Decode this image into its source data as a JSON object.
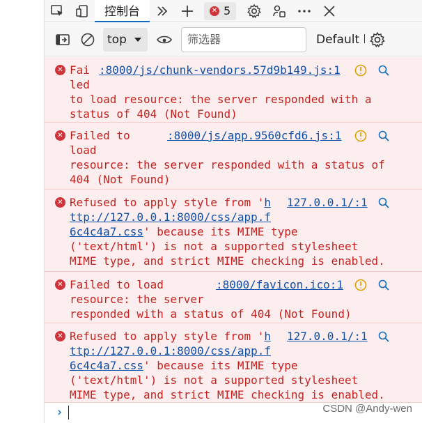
{
  "tabbar": {
    "active_tab": "控制台",
    "error_count": "5",
    "icons": [
      "inspect-icon",
      "device-icon",
      "more-tabs-icon",
      "add-tab-icon",
      "settings-icon",
      "customize-icon",
      "more-icon",
      "close-icon"
    ]
  },
  "toolbar": {
    "context": "top",
    "filter_placeholder": "筛选器",
    "levels": "Default l"
  },
  "messages": [
    {
      "lines": [
        "Fai",
        "led",
        "to load resource: the server responded with a",
        "status of 404 (Not Found)"
      ],
      "source": ":8000/js/chunk-vendors.57d9b149.js:1",
      "has_warning_action": true
    },
    {
      "lines": [
        "Failed to",
        "load",
        "resource: the server responded with a status of",
        "404 (Not Found)"
      ],
      "source": ":8000/js/app.9560cfd6.js:1",
      "has_warning_action": true
    },
    {
      "lines": [
        "Refused to apply style from '",
        "h",
        "ttp://127.0.0.1:8000/css/app.f",
        "6c4c4a7.css",
        "' because its MIME type",
        "('text/html') is not a supported stylesheet",
        "MIME type, and strict MIME checking is enabled."
      ],
      "source": "127.0.0.1/:1",
      "has_warning_action": false
    },
    {
      "lines": [
        "Failed to load",
        "resource: the server",
        "responded with a status of 404 (Not Found)"
      ],
      "source": ":8000/favicon.ico:1",
      "has_warning_action": true
    },
    {
      "lines": [
        "Refused to apply style from '",
        "h",
        "ttp://127.0.0.1:8000/css/app.f",
        "6c4c4a7.css",
        "' because its MIME type",
        "('text/html') is not a supported stylesheet",
        "MIME type, and strict MIME checking is enabled."
      ],
      "source": "127.0.0.1/:1",
      "has_warning_action": false
    }
  ],
  "watermark": "CSDN @Andy-wen",
  "colors": {
    "error_bg": "#fceeee",
    "error_text": "#c5221f",
    "link": "#0f4fa8",
    "accent": "#0f6cbd"
  }
}
